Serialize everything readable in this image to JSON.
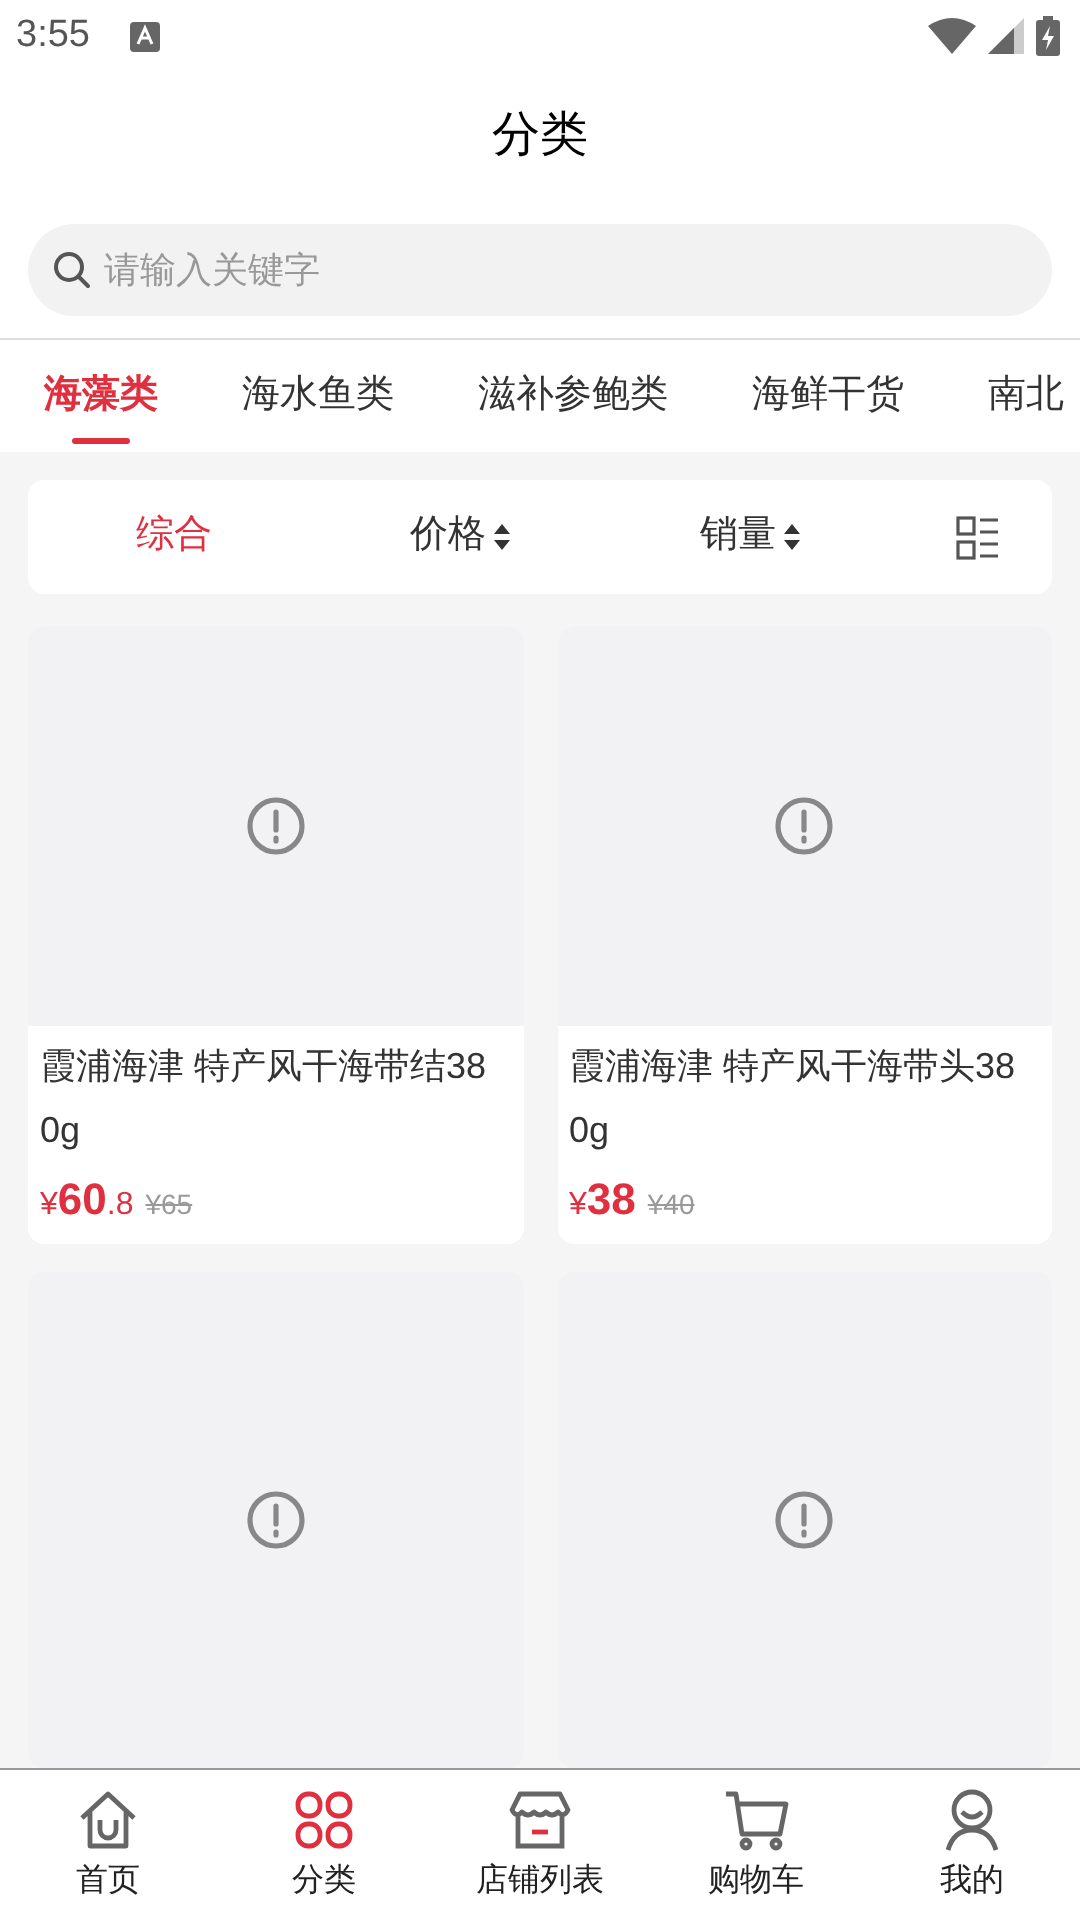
{
  "status_bar": {
    "time": "3:55"
  },
  "title": "分类",
  "search": {
    "placeholder": "请输入关键字"
  },
  "tabs": [
    {
      "label": "海藻类",
      "selected": true
    },
    {
      "label": "海水鱼类",
      "selected": false
    },
    {
      "label": "滋补参鲍类",
      "selected": false
    },
    {
      "label": "海鲜干货",
      "selected": false
    },
    {
      "label": "南北",
      "selected": false
    }
  ],
  "sort_options": [
    {
      "label": "综合",
      "kind": "plain",
      "selected": true
    },
    {
      "label": "价格",
      "kind": "sortable",
      "selected": false
    },
    {
      "label": "销量",
      "kind": "sortable",
      "selected": false
    }
  ],
  "products": [
    {
      "kind": "full",
      "title": "霞浦海津 特产风干海带结380g",
      "currency": "¥",
      "price_main": "60",
      "price_fraction": ".8",
      "original_price": "¥65"
    },
    {
      "kind": "full",
      "title": "霞浦海津 特产风干海带头380g",
      "currency": "¥",
      "price_main": "38",
      "original_price": "¥40"
    },
    {
      "kind": "image_only"
    },
    {
      "kind": "image_only"
    }
  ],
  "bottom_nav": [
    {
      "label": "首页",
      "kind": "home",
      "selected": false
    },
    {
      "label": "分类",
      "kind": "grid",
      "selected": true
    },
    {
      "label": "店铺列表",
      "kind": "store",
      "selected": false
    },
    {
      "label": "购物车",
      "kind": "cart",
      "selected": false
    },
    {
      "label": "我的",
      "kind": "user",
      "selected": false
    }
  ]
}
